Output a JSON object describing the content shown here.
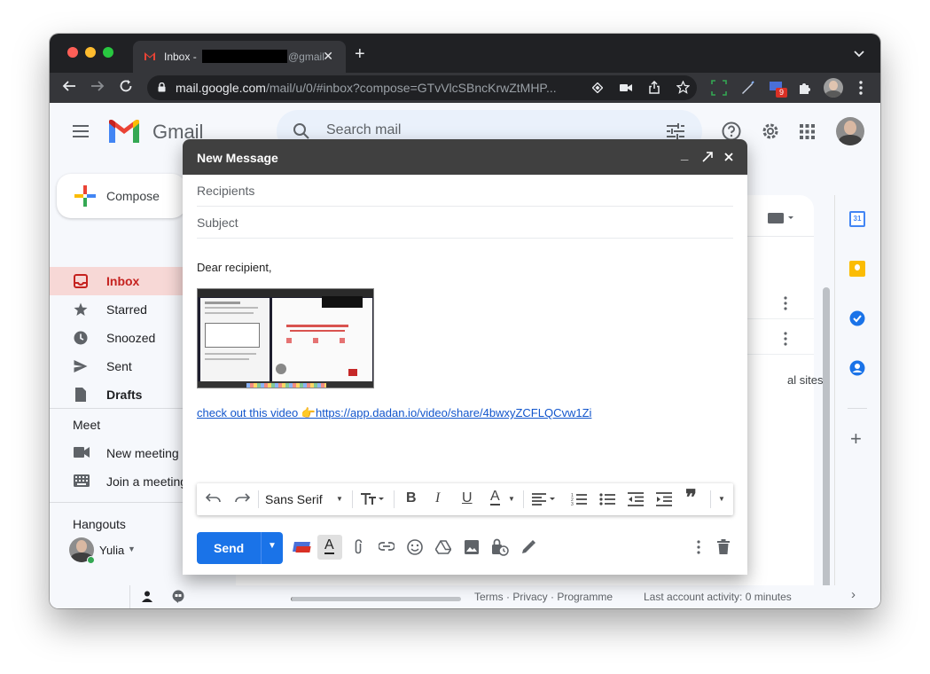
{
  "browser": {
    "tab_title_prefix": "Inbox - ",
    "tab_title_suffix": "@gmail",
    "url_host": "mail.google.com",
    "url_path": "/mail/u/0/#inbox?compose=GTvVlcSBncKrwZtMHP...",
    "extension_badge": "9"
  },
  "gmail": {
    "app_name": "Gmail",
    "search_placeholder": "Search mail",
    "compose_label": "Compose",
    "nav": [
      {
        "label": "Inbox",
        "icon": "inbox-icon"
      },
      {
        "label": "Starred",
        "icon": "star-icon"
      },
      {
        "label": "Snoozed",
        "icon": "clock-icon"
      },
      {
        "label": "Sent",
        "icon": "send-icon"
      },
      {
        "label": "Drafts",
        "icon": "draft-icon"
      }
    ],
    "meet": {
      "title": "Meet",
      "items": [
        {
          "label": "New meeting",
          "icon": "video-icon"
        },
        {
          "label": "Join a meeting",
          "icon": "keyboard-icon"
        }
      ]
    },
    "hangouts": {
      "title": "Hangouts",
      "user": "Yulia"
    },
    "bg_fragment": "al sites",
    "footer": {
      "links": "Terms · Privacy · Programme",
      "activity": "Last account activity: 0 minutes"
    }
  },
  "compose_window": {
    "title": "New Message",
    "recipients_placeholder": "Recipients",
    "subject_placeholder": "Subject",
    "greeting": "Dear recipient,",
    "link_text": "check out this video 👉https://app.dadan.io/video/share/4bwxyZCFLQCvw1Zi",
    "font_name": "Sans Serif",
    "send_label": "Send"
  },
  "colors": {
    "accent": "#1a73e8",
    "inbox_active": "#c5221f",
    "dialog_header": "#404040"
  }
}
